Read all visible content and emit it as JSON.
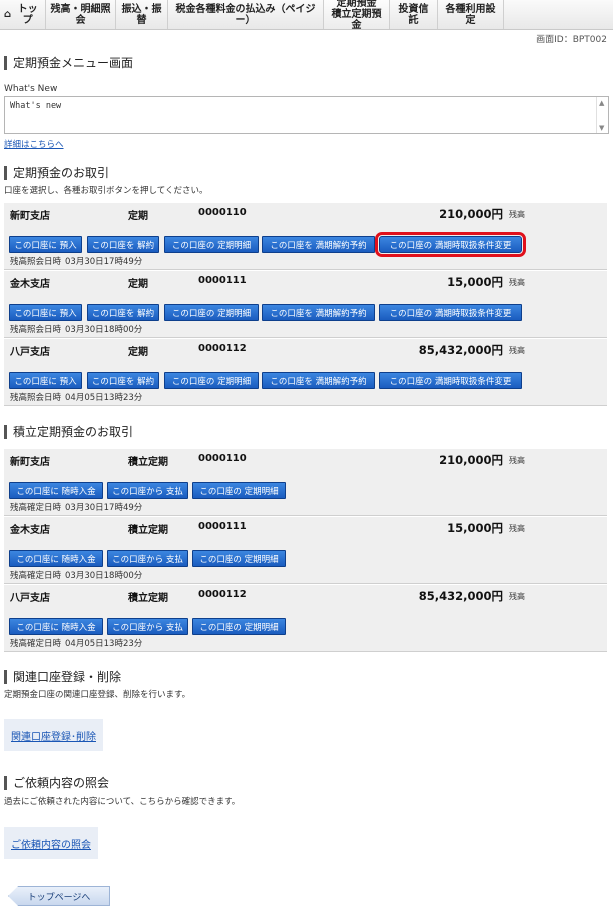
{
  "nav": {
    "items": [
      {
        "label": "トップ",
        "icon": "home-icon"
      },
      {
        "label": "残高・明細照会"
      },
      {
        "label": "振込・振替"
      },
      {
        "label": "税金各種料金の払込み（ペイジー）"
      },
      {
        "label_line1": "定期預金",
        "label_line2": "積立定期預金"
      },
      {
        "label": "投資信託"
      },
      {
        "label": "各種利用設定"
      }
    ]
  },
  "screen_id": "画面ID：BPT002",
  "page_title": "定期預金メニュー画面",
  "whats_new": {
    "label": "What's New",
    "content": "What's new",
    "detail_link": "詳細はこちらへ"
  },
  "time_deposit": {
    "title": "定期預金のお取引",
    "note": "口座を選択し、各種お取引ボタンを押してください。",
    "time_label": "残高照会日時",
    "buttons": [
      "この口座に 預入",
      "この口座を 解約",
      "この口座の 定期明細",
      "この口座を 満期解約予約",
      "この口座の 満期時取扱条件変更"
    ],
    "accounts": [
      {
        "branch": "新町支店",
        "type": "定期",
        "number": "0000110",
        "amount": "210,000円",
        "unit": "残高",
        "time": "03月30日17時49分"
      },
      {
        "branch": "金木支店",
        "type": "定期",
        "number": "0000111",
        "amount": "15,000円",
        "unit": "残高",
        "time": "03月30日18時00分"
      },
      {
        "branch": "八戸支店",
        "type": "定期",
        "number": "0000112",
        "amount": "85,432,000円",
        "unit": "残高",
        "time": "04月05日13時23分"
      }
    ]
  },
  "installment": {
    "title": "積立定期預金のお取引",
    "time_label": "残高確定日時",
    "buttons": [
      "この口座に 随時入金",
      "この口座から 支払",
      "この口座の 定期明細"
    ],
    "accounts": [
      {
        "branch": "新町支店",
        "type": "積立定期",
        "number": "0000110",
        "amount": "210,000円",
        "unit": "残高",
        "time": "03月30日17時49分"
      },
      {
        "branch": "金木支店",
        "type": "積立定期",
        "number": "0000111",
        "amount": "15,000円",
        "unit": "残高",
        "time": "03月30日18時00分"
      },
      {
        "branch": "八戸支店",
        "type": "積立定期",
        "number": "0000112",
        "amount": "85,432,000円",
        "unit": "残高",
        "time": "04月05日13時23分"
      }
    ]
  },
  "related": {
    "title": "関連口座登録・削除",
    "note": "定期預金口座の関連口座登録、削除を行います。",
    "link": "関連口座登録･削除"
  },
  "inquiry": {
    "title": "ご依頼内容の照会",
    "note": "過去にご依頼された内容について、こちらから確認できます。",
    "link": "ご依頼内容の照会"
  },
  "top_page_button": "トップページへ",
  "colors": {
    "button": "#1a5cbf",
    "highlight": "#e0101b",
    "link": "#1a56b5"
  }
}
